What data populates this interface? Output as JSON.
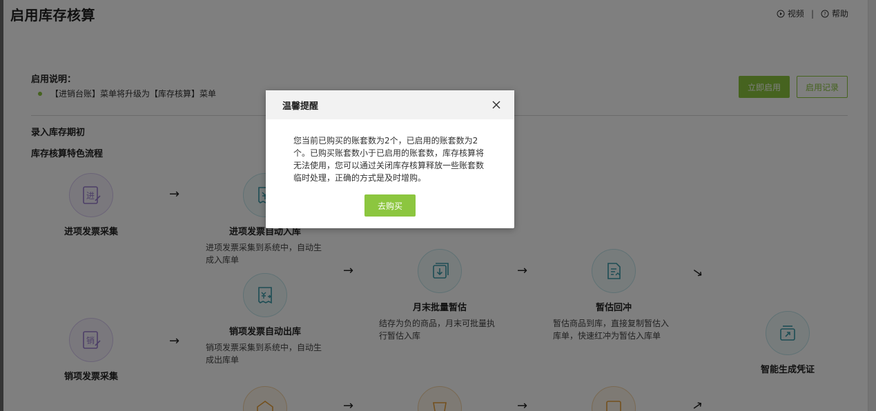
{
  "page": {
    "title": "启用库存核算",
    "video_label": "视频",
    "sep": "|",
    "help_label": "帮助"
  },
  "intro": {
    "title": "启用说明：",
    "item": "【进销台账】菜单将升级为【库存核算】菜单"
  },
  "actions": {
    "enable_label": "立即启用",
    "records_label": "启用记录"
  },
  "sections": {
    "initial": "录入库存期初",
    "flow": "库存核算特色流程"
  },
  "flow": {
    "arrow": "→",
    "nodes": [
      {
        "label": "进项发票采集",
        "desc": ""
      },
      {
        "label": "销项发票采集",
        "desc": ""
      },
      {
        "label": "进项发票自动入库",
        "desc": "进项发票采集到系统中，自动生成入库单"
      },
      {
        "label": "销项发票自动出库",
        "desc": "销项发票采集到系统中，自动生成出库单"
      },
      {
        "label": "月末批量暂估",
        "desc": "结存为负的商品，月末可批量执行暂估入库"
      },
      {
        "label": "暂估回冲",
        "desc": "暂估商品到库，直接复制暂估入库单，快速红冲为暂估入库单"
      },
      {
        "label": "智能生成凭证",
        "desc": ""
      }
    ],
    "icon_text": {
      "in": "进",
      "out": "销"
    }
  },
  "dialog": {
    "title": "温馨提醒",
    "message": "您当前已购买的账套数为2个，已启用的账套数为2个。已购买账套数小于已启用的账套数，库存核算将无法使用，您可以通过关闭库存核算释放一些账套数临时处理，正确的方式是及时增购。",
    "button_label": "去购买"
  },
  "colors": {
    "accent": "#8cc63f",
    "teal": "#3a9aa8",
    "purple": "#9b7fcf",
    "orange": "#e7a13a"
  }
}
